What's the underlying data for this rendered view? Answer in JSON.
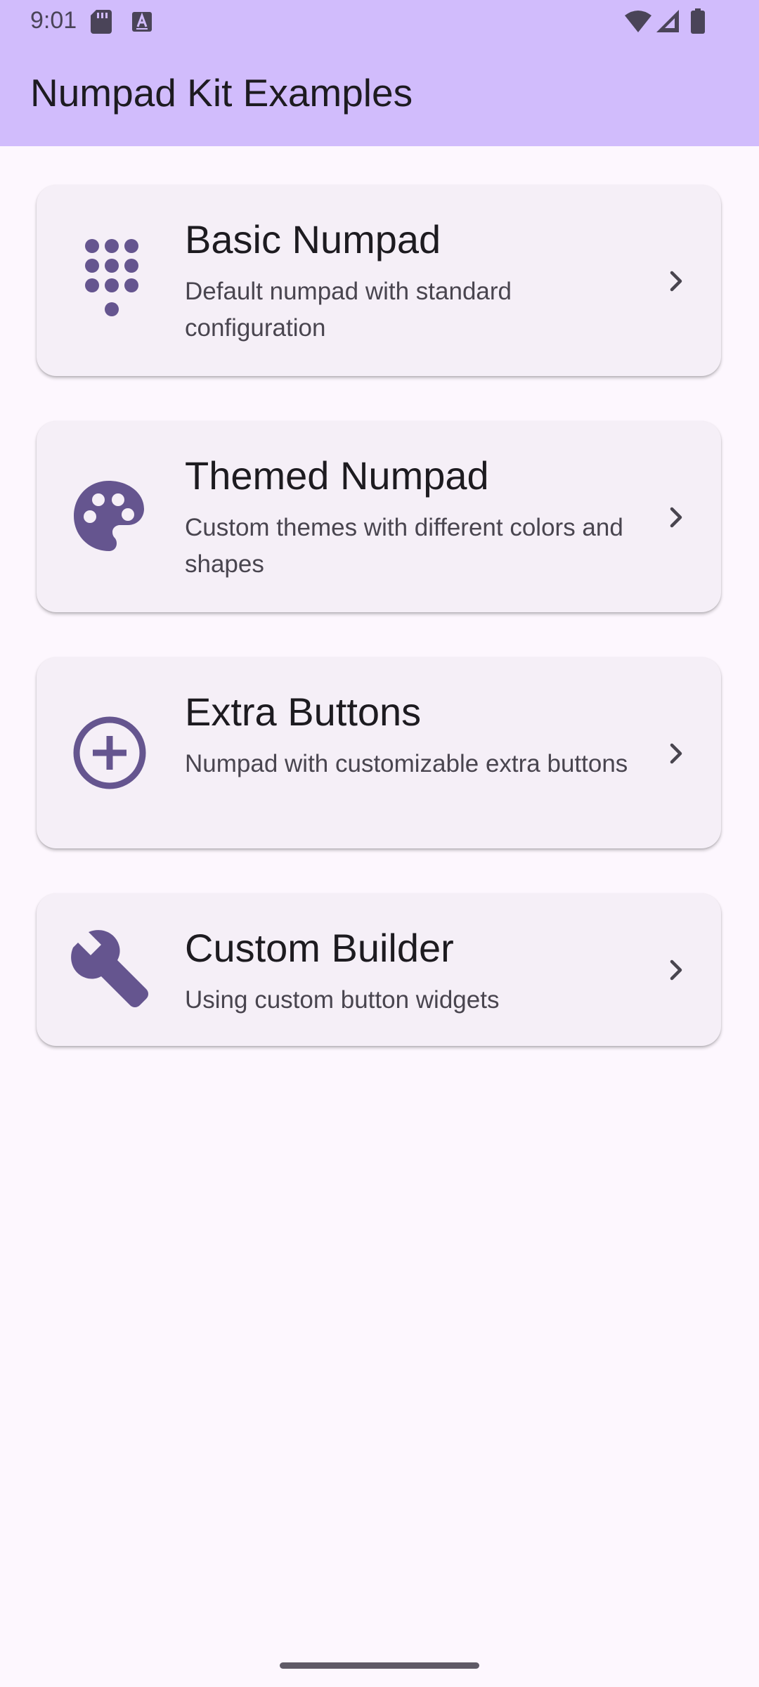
{
  "status_bar": {
    "time": "9:01",
    "icons": [
      "sd-card-icon",
      "keyboard-a-icon",
      "wifi-icon",
      "signal-icon",
      "battery-icon"
    ]
  },
  "app_bar": {
    "title": "Numpad Kit Examples"
  },
  "colors": {
    "app_bar_bg": "#D1BCFC",
    "background": "#FDF7FE",
    "card_bg": "#F5EFF7",
    "icon_color": "#65558F",
    "title_color": "#1D1B20",
    "subtitle_color": "#49454F"
  },
  "items": [
    {
      "icon": "dialpad-icon",
      "title": "Basic Numpad",
      "subtitle": "Default numpad with standard configuration"
    },
    {
      "icon": "palette-icon",
      "title": "Themed Numpad",
      "subtitle": "Custom themes with different colors and shapes"
    },
    {
      "icon": "add-circle-icon",
      "title": "Extra Buttons",
      "subtitle": "Numpad with customizable extra buttons"
    },
    {
      "icon": "wrench-icon",
      "title": "Custom Builder",
      "subtitle": "Using custom button widgets"
    }
  ]
}
